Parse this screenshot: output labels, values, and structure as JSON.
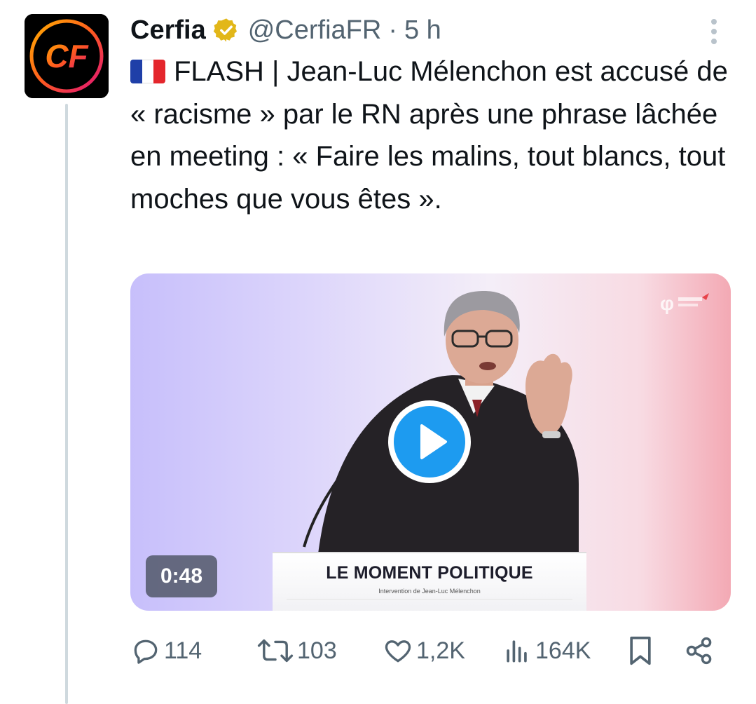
{
  "author": {
    "display_name": "Cerfia",
    "handle": "@CerfiaFR",
    "separator": "·",
    "time": "5 h",
    "avatar_initials": "CF",
    "verified_color": "#e2b719"
  },
  "tweet": {
    "text": "FLASH | Jean-Luc Mélenchon est accusé de « racisme » par le RN après une phrase lâchée en meeting : « Faire les malins, tout blancs, tout moches que vous êtes ».",
    "flag_icon": "france-flag-icon"
  },
  "media": {
    "type": "video",
    "duration": "0:48",
    "podium_title": "LE MOMENT POLITIQUE",
    "podium_subtitle": "Intervention de Jean-Luc Mélenchon",
    "play_color": "#1d9bf0"
  },
  "actions": {
    "replies": "114",
    "reposts": "103",
    "likes": "1,2K",
    "views": "164K"
  },
  "colors": {
    "text": "#0f1419",
    "secondary": "#536471",
    "accent": "#1d9bf0"
  }
}
